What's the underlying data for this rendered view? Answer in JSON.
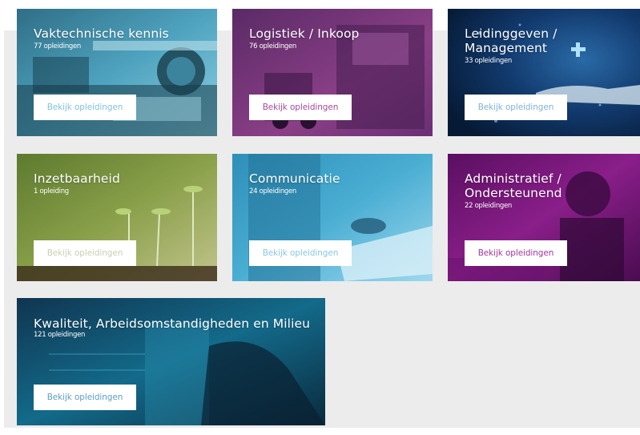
{
  "categories": [
    {
      "title": "Vaktechnische kennis",
      "count": "77 opleidingen",
      "button": "Bekijk opleidingen",
      "color": "#5fb6cf",
      "btn_text_color": "#7fc3dc"
    },
    {
      "title": "Logistiek / Inkoop",
      "count": "76 opleidingen",
      "button": "Bekijk opleidingen",
      "color": "#8a3f86",
      "btn_text_color": "#a44a9a"
    },
    {
      "title": "Leidinggeven /\nManagement",
      "count": "33 opleidingen",
      "button": "Bekijk opleidingen",
      "color": "#0f2f5f",
      "btn_text_color": "#7fb2d8"
    },
    {
      "title": "Inzetbaarheid",
      "count": "1 opleiding",
      "button": "Bekijk opleidingen",
      "color": "#6f7f3a",
      "btn_text_color": "#c9cfb4"
    },
    {
      "title": "Communicatie",
      "count": "24 opleidingen",
      "button": "Bekijk opleidingen",
      "color": "#4aaed3",
      "btn_text_color": "#86c8e4"
    },
    {
      "title": "Administratief /\nOndersteunend",
      "count": "22 opleidingen",
      "button": "Bekijk opleidingen",
      "color": "#7a1a7d",
      "btn_text_color": "#a4359c"
    },
    {
      "title": "Kwaliteit, Arbeidsomstandigheden en Milieu",
      "count": "121 opleidingen",
      "button": "Bekijk opleidingen",
      "color": "#0c4f6e",
      "btn_text_color": "#5d9fc2"
    }
  ]
}
